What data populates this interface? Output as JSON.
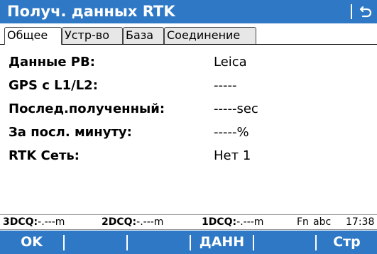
{
  "window": {
    "title": "Получ. данных RTK",
    "back_icon": "return-arrow-icon"
  },
  "tabs": [
    {
      "label": "Общее",
      "active": true
    },
    {
      "label": "Устр-во",
      "active": false
    },
    {
      "label": "База",
      "active": false
    },
    {
      "label": "Соединение",
      "active": false
    }
  ],
  "fields": [
    {
      "label": "Данные РВ:",
      "value": "Leica"
    },
    {
      "label": "GPS с L1/L2:",
      "value": "-----"
    },
    {
      "label": "Послед.полученный:",
      "value": "-----sec"
    },
    {
      "label": "За посл. минуту:",
      "value": "-----%"
    },
    {
      "label": "RTK Сеть:",
      "value": "Нет 1"
    }
  ],
  "status": {
    "dcq3_label": "3DCQ:",
    "dcq3_value": "-.---m",
    "dcq2_label": "2DCQ:",
    "dcq2_value": "-.---m",
    "dcq1_label": "1DCQ:",
    "dcq1_value": "-.---m",
    "fn": "Fn",
    "input_mode": "abc",
    "time": "17:38"
  },
  "softkeys": [
    "OK",
    "",
    "",
    "ДАНН",
    "",
    "Стр"
  ],
  "colors": {
    "accent": "#2e78c6",
    "text_on_accent": "#ffffff"
  }
}
